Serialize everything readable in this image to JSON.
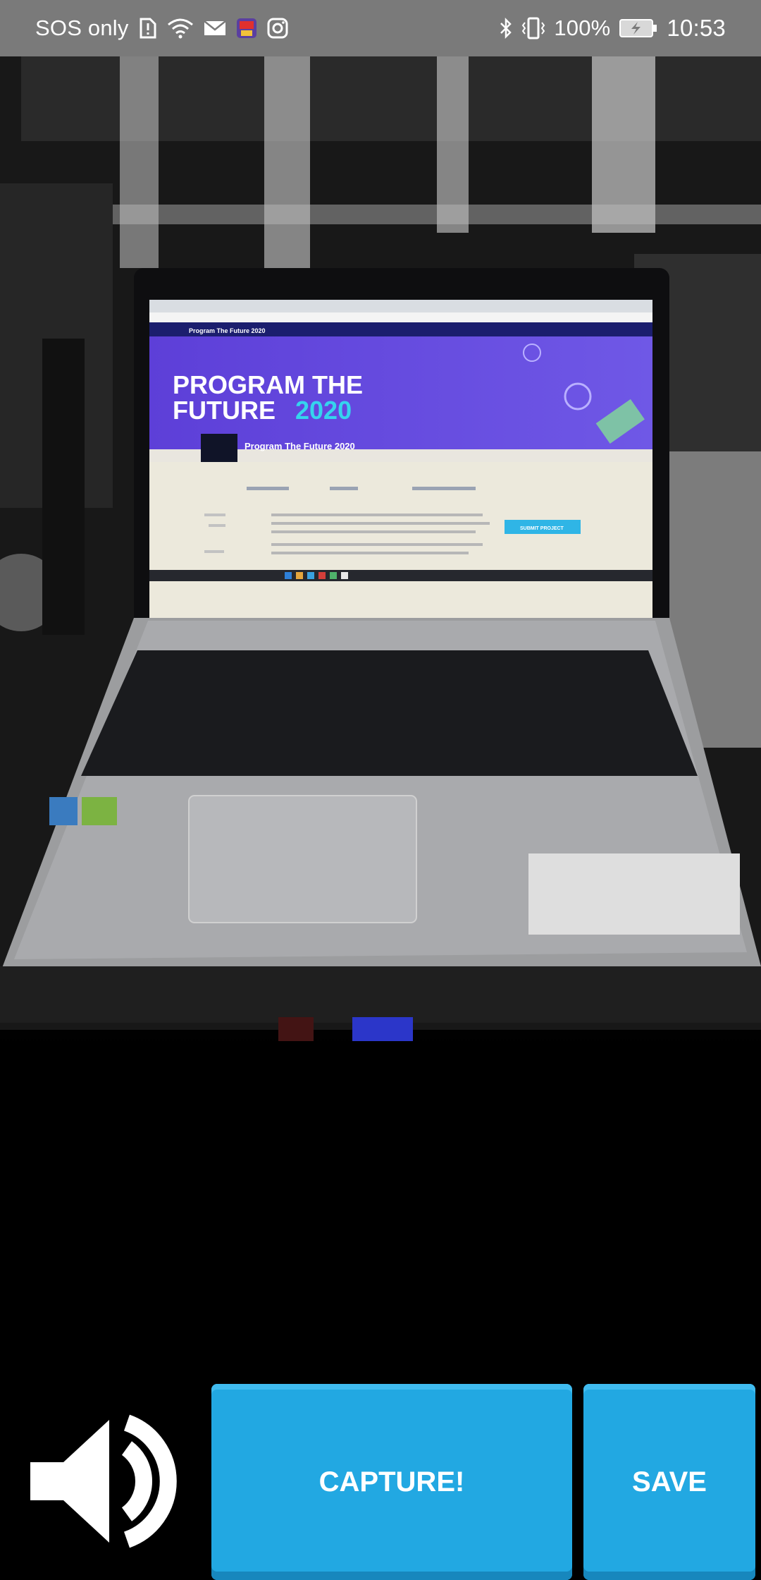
{
  "status_bar": {
    "carrier": "SOS only",
    "battery": "100%",
    "time": "10:53"
  },
  "screen_text": {
    "header": "Program The Future 2020",
    "hero_line1": "PROGRAM THE",
    "hero_line2_a": "FUTURE",
    "hero_line2_b": "2020",
    "project_title": "Program The Future 2020",
    "submit": "SUBMIT PROJECT"
  },
  "controls": {
    "capture_label": "CAPTURE!",
    "save_label": "SAVE"
  },
  "colors": {
    "button": "#22a8e2",
    "status_bar": "#7a7a7a"
  }
}
